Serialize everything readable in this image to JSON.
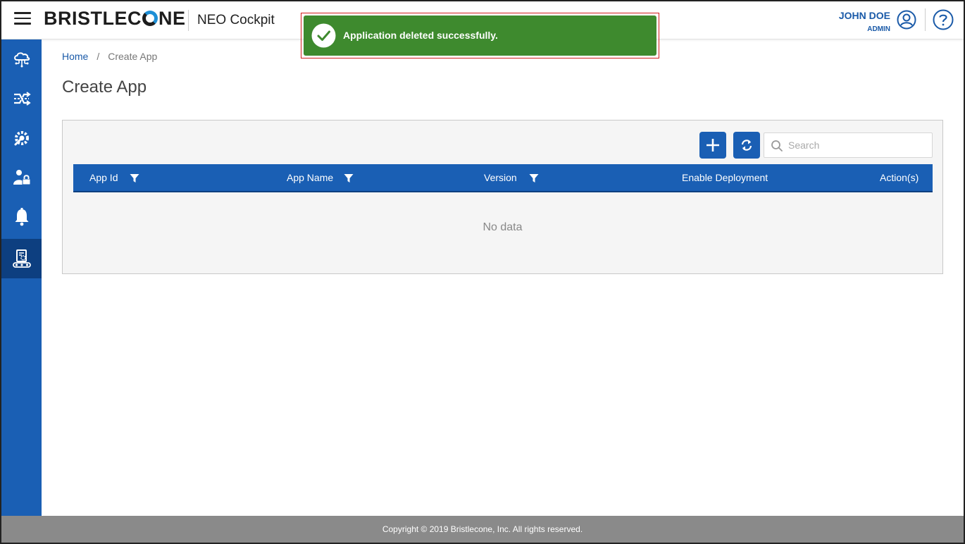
{
  "header": {
    "brand_left": "BRISTLEC",
    "brand_right": "NE",
    "app_name": "NEO Cockpit",
    "user_name": "JOHN DOE",
    "user_role": "ADMIN",
    "icons": [
      "hamburger-menu-icon",
      "user-circle-icon",
      "help-circle-icon"
    ]
  },
  "sidebar": {
    "items": [
      {
        "icon": "cloud-network-icon",
        "active": false
      },
      {
        "icon": "shuffle-flow-icon",
        "active": false
      },
      {
        "icon": "gear-wrench-icon",
        "active": false
      },
      {
        "icon": "user-lock-icon",
        "active": false
      },
      {
        "icon": "bell-icon",
        "active": false
      },
      {
        "icon": "app-conveyor-icon",
        "active": true
      }
    ]
  },
  "breadcrumb": {
    "home": "Home",
    "separator": "/",
    "current": "Create App"
  },
  "page": {
    "title": "Create App"
  },
  "toolbar": {
    "add_icon": "plus-icon",
    "refresh_icon": "refresh-icon",
    "search_placeholder": "Search"
  },
  "table": {
    "columns": [
      {
        "label": "App Id",
        "filter": true
      },
      {
        "label": "App Name",
        "filter": true
      },
      {
        "label": "Version",
        "filter": true
      },
      {
        "label": "Enable Deployment",
        "filter": false
      },
      {
        "label": "Action(s)",
        "filter": false
      }
    ],
    "rows": [],
    "empty_text": "No data"
  },
  "toast": {
    "message": "Application deleted successfully.",
    "type": "success",
    "color": "#3e8a2e"
  },
  "footer": {
    "copyright": "Copyright © 2019 Bristlecone, Inc. All rights reserved."
  },
  "colors": {
    "primary": "#1a5fb4",
    "primary_dark": "#0d3f80",
    "footer": "#8a8a8a"
  }
}
